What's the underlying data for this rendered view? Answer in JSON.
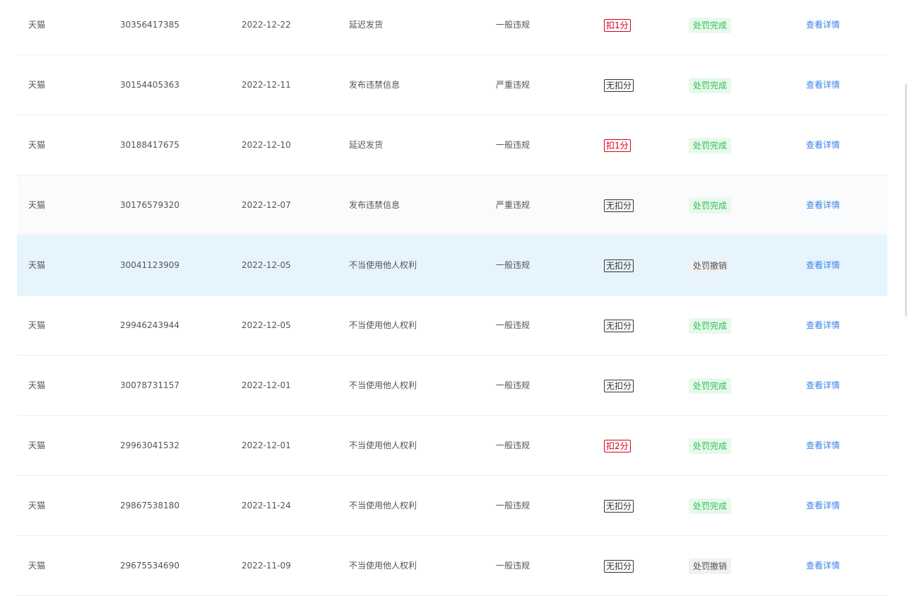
{
  "rows": [
    {
      "platform": "天猫",
      "id": "30356417385",
      "date": "2022-12-22",
      "reason": "延迟发货",
      "level": "一般违规",
      "points": "扣1分",
      "points_type": "deduct",
      "status": "处罚完成",
      "status_type": "done",
      "action": "查看详情"
    },
    {
      "platform": "天猫",
      "id": "30154405363",
      "date": "2022-12-11",
      "reason": "发布违禁信息",
      "level": "严重违规",
      "points": "无扣分",
      "points_type": "none",
      "status": "处罚完成",
      "status_type": "done",
      "action": "查看详情"
    },
    {
      "platform": "天猫",
      "id": "30188417675",
      "date": "2022-12-10",
      "reason": "延迟发货",
      "level": "一般违规",
      "points": "扣1分",
      "points_type": "deduct",
      "status": "处罚完成",
      "status_type": "done",
      "action": "查看详情"
    },
    {
      "platform": "天猫",
      "id": "30176579320",
      "date": "2022-12-07",
      "reason": "发布违禁信息",
      "level": "严重违规",
      "points": "无扣分",
      "points_type": "none",
      "status": "处罚完成",
      "status_type": "done",
      "action": "查看详情"
    },
    {
      "platform": "天猫",
      "id": "30041123909",
      "date": "2022-12-05",
      "reason": "不当使用他人权利",
      "level": "一般违规",
      "points": "无扣分",
      "points_type": "none",
      "status": "处罚撤销",
      "status_type": "revoked",
      "action": "查看详情"
    },
    {
      "platform": "天猫",
      "id": "29946243944",
      "date": "2022-12-05",
      "reason": "不当使用他人权利",
      "level": "一般违规",
      "points": "无扣分",
      "points_type": "none",
      "status": "处罚完成",
      "status_type": "done",
      "action": "查看详情"
    },
    {
      "platform": "天猫",
      "id": "30078731157",
      "date": "2022-12-01",
      "reason": "不当使用他人权利",
      "level": "一般违规",
      "points": "无扣分",
      "points_type": "none",
      "status": "处罚完成",
      "status_type": "done",
      "action": "查看详情"
    },
    {
      "platform": "天猫",
      "id": "29963041532",
      "date": "2022-12-01",
      "reason": "不当使用他人权利",
      "level": "一般违规",
      "points": "扣2分",
      "points_type": "deduct",
      "status": "处罚完成",
      "status_type": "done",
      "action": "查看详情"
    },
    {
      "platform": "天猫",
      "id": "29867538180",
      "date": "2022-11-24",
      "reason": "不当使用他人权利",
      "level": "一般违规",
      "points": "无扣分",
      "points_type": "none",
      "status": "处罚完成",
      "status_type": "done",
      "action": "查看详情"
    },
    {
      "platform": "天猫",
      "id": "29675534690",
      "date": "2022-11-09",
      "reason": "不当使用他人权利",
      "level": "一般违规",
      "points": "无扣分",
      "points_type": "none",
      "status": "处罚撤销",
      "status_type": "revoked",
      "action": "查看详情"
    }
  ],
  "colors": {
    "deduct": "#d9001b",
    "status_done_bg": "#e8f9ec",
    "status_done_text": "#2fbf55",
    "link": "#3b82e8",
    "row_hover": "#e6f4fd"
  }
}
